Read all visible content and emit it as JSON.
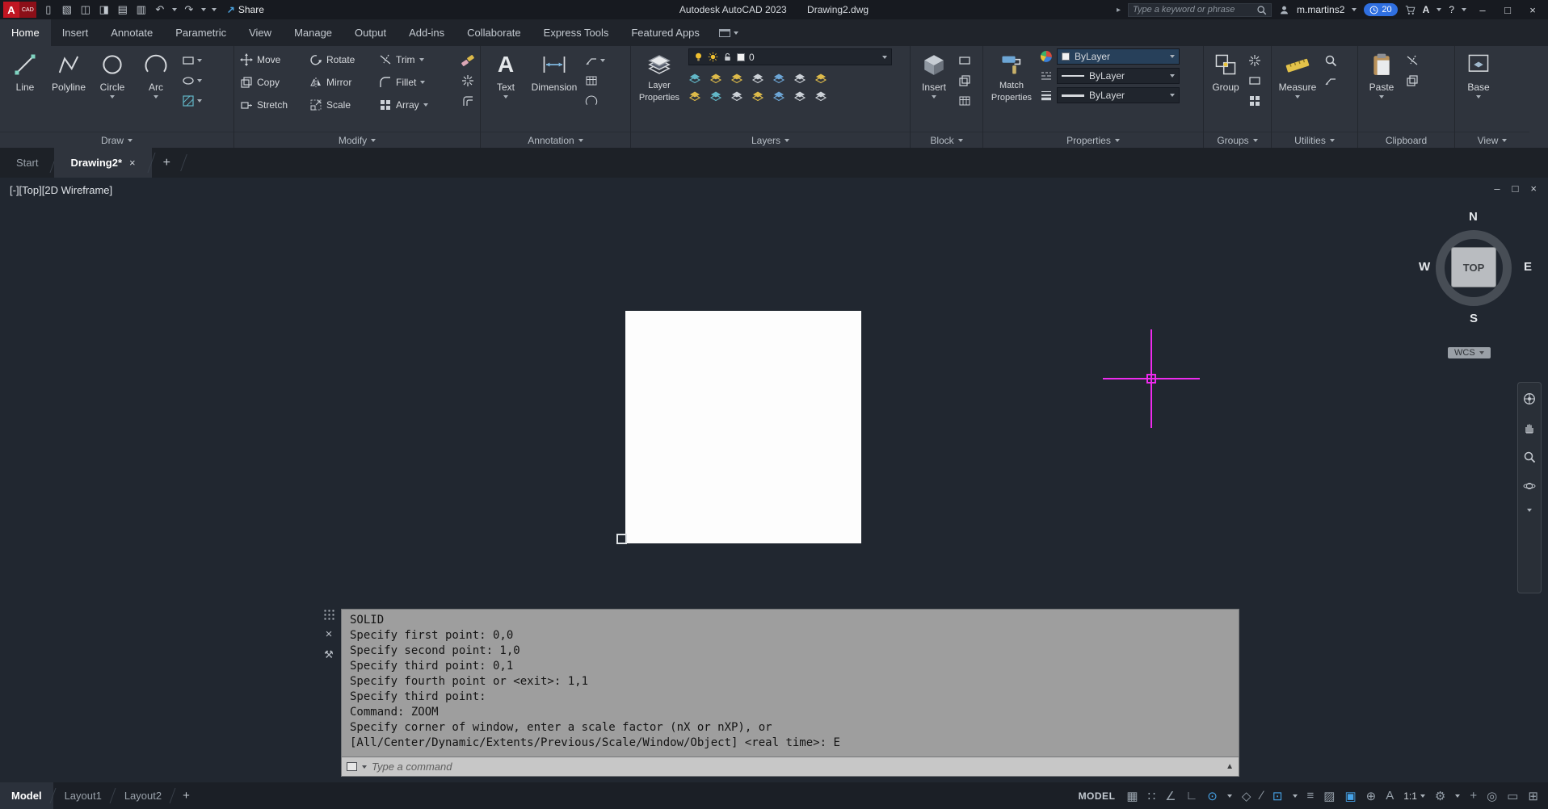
{
  "titlebar": {
    "share": "Share",
    "app_title": "Autodesk AutoCAD 2023",
    "doc_title": "Drawing2.dwg",
    "search_placeholder": "Type a keyword or phrase",
    "username": "m.martins2",
    "timer_badge": "20",
    "help": "?"
  },
  "ribbon_tabs": [
    "Home",
    "Insert",
    "Annotate",
    "Parametric",
    "View",
    "Manage",
    "Output",
    "Add-ins",
    "Collaborate",
    "Express Tools",
    "Featured Apps"
  ],
  "draw": {
    "title": "Draw",
    "line": "Line",
    "polyline": "Polyline",
    "circle": "Circle",
    "arc": "Arc"
  },
  "modify": {
    "title": "Modify",
    "move": "Move",
    "rotate": "Rotate",
    "trim": "Trim",
    "copy": "Copy",
    "mirror": "Mirror",
    "fillet": "Fillet",
    "stretch": "Stretch",
    "scale": "Scale",
    "array": "Array"
  },
  "annotation": {
    "title": "Annotation",
    "text": "Text",
    "dimension": "Dimension"
  },
  "layers": {
    "title": "Layers",
    "lp1": "Layer",
    "lp2": "Properties",
    "current_layer": "0"
  },
  "block": {
    "title": "Block",
    "insert": "Insert"
  },
  "properties": {
    "title": "Properties",
    "m1": "Match",
    "m2": "Properties",
    "color": "ByLayer",
    "linetype": "ByLayer",
    "lineweight": "ByLayer"
  },
  "groups": {
    "title": "Groups",
    "group": "Group"
  },
  "utilities": {
    "title": "Utilities",
    "measure": "Measure"
  },
  "clipboard_panel": {
    "title": "Clipboard",
    "paste": "Paste"
  },
  "view_panel": {
    "title": "View",
    "base": "Base"
  },
  "file_tabs": {
    "start": "Start",
    "drawing": "Drawing2*",
    "close": "×",
    "add": "+"
  },
  "viewport": {
    "label": "[-][Top][2D Wireframe]",
    "cube_n": "N",
    "cube_w": "W",
    "cube_e": "E",
    "cube_s": "S",
    "cube_face": "TOP",
    "wcs": "WCS"
  },
  "command": {
    "lines": [
      "SOLID",
      "Specify first point: 0,0",
      "Specify second point: 1,0",
      "Specify third point: 0,1",
      "Specify fourth point or <exit>: 1,1",
      "Specify third point:",
      "Command: ZOOM",
      "Specify corner of window, enter a scale factor (nX or nXP), or",
      "[All/Center/Dynamic/Extents/Previous/Scale/Window/Object] <real time>: E"
    ],
    "input_placeholder": "Type a command"
  },
  "statusbar": {
    "model": "Model",
    "layout1": "Layout1",
    "layout2": "Layout2",
    "add": "+",
    "mode": "MODEL",
    "scale": "1:1"
  },
  "icons": {
    "logo_a": "A",
    "logo_cad": "CAD",
    "new": "▯",
    "open": "▧",
    "save": "◫",
    "save_as": "◨",
    "print": "▤",
    "plot": "▥",
    "undo": "↶",
    "redo": "↷",
    "share_arrow": "↗",
    "expand_right": "▸",
    "app_a": "A",
    "text_tool": "A",
    "minimize": "–",
    "maximize": "□",
    "close": "×",
    "vp_min": "–",
    "vp_max": "□",
    "vp_close": "×",
    "cmd_close": "×",
    "cmd_wrench": "⚒",
    "scroll_up": "▲",
    "grid": "▦",
    "snap": "∷",
    "infer": "∠",
    "ortho": "∟",
    "polar": "⊙",
    "isodraft": "◇",
    "otrack": "∕",
    "osnap": "⊡",
    "lineweight": "≡",
    "transparency": "▨",
    "selection": "▣",
    "dyninput": "⊕",
    "annot": "A",
    "gear": "⚙",
    "plus": "+",
    "isolate": "◎",
    "perf": "▭",
    "fullscreen": "⊞"
  }
}
